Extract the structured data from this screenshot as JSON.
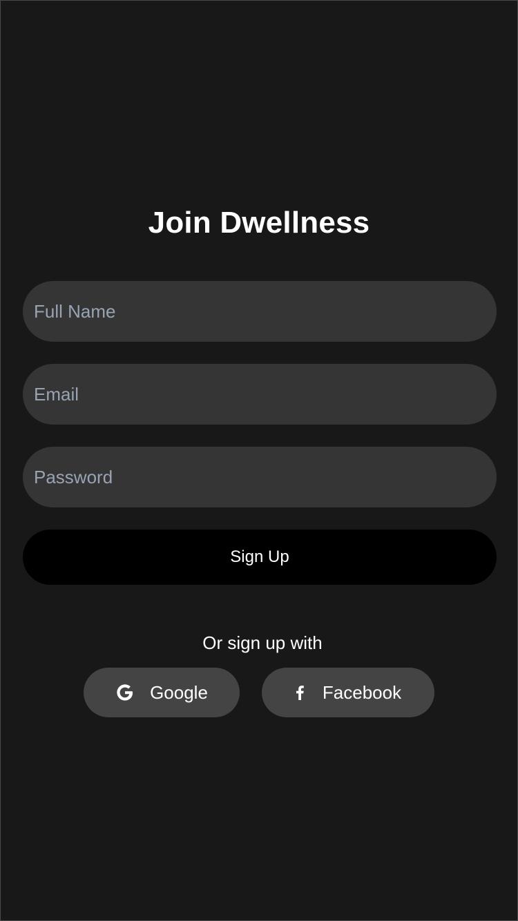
{
  "page": {
    "title": "Join Dwellness"
  },
  "form": {
    "full_name": {
      "value": "",
      "placeholder": "Full Name"
    },
    "email": {
      "value": "",
      "placeholder": "Email"
    },
    "password": {
      "value": "",
      "placeholder": "Password"
    },
    "submit_label": "Sign Up"
  },
  "social": {
    "prompt": "Or sign up with",
    "buttons": [
      {
        "label": "Google",
        "icon": "google-icon"
      },
      {
        "label": "Facebook",
        "icon": "facebook-icon"
      }
    ]
  },
  "colors": {
    "background": "#181818",
    "input_background": "#353535",
    "placeholder": "#98a3b3",
    "primary_button": "#000000",
    "social_button": "#444444",
    "text": "#ffffff"
  }
}
